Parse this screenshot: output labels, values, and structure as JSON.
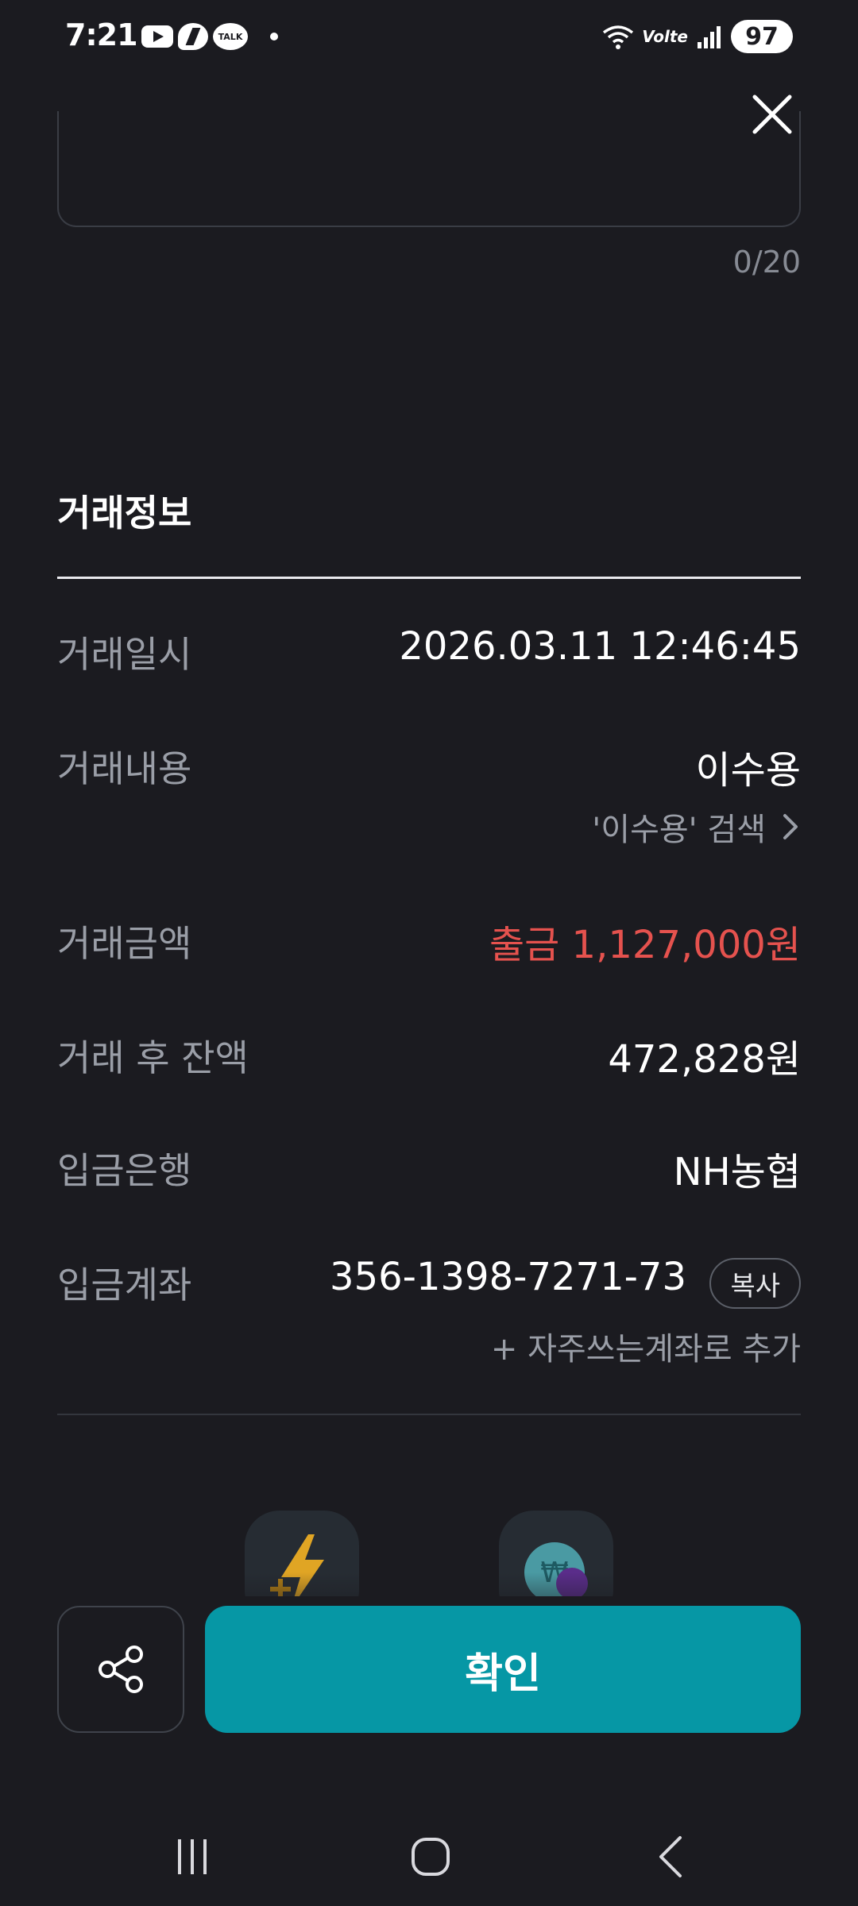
{
  "status_bar": {
    "time": "7:21",
    "notification_icons": [
      "youtube-icon",
      "messenger-icon",
      "kakaotalk-icon",
      "dot-icon"
    ],
    "talk_label": "TALK",
    "network_label": "Volte",
    "battery": "97"
  },
  "memo": {
    "counter": "0/20"
  },
  "transaction_info": {
    "title": "거래정보",
    "rows": [
      {
        "label": "거래일시",
        "value": "2026.03.11 12:46:45"
      },
      {
        "label": "거래내용",
        "value": "이수용",
        "sub_link": "'이수용' 검색"
      },
      {
        "label": "거래금액",
        "value": "출금 1,127,000원"
      },
      {
        "label": "거래 후 잔액",
        "value": "472,828원"
      },
      {
        "label": "입금은행",
        "value": "NH농협"
      },
      {
        "label": "입금계좌",
        "value": "356-1398-7271-73",
        "copy_label": "복사",
        "add_label": "+ 자주쓰는계좌로 추가"
      }
    ]
  },
  "actions": {
    "confirm_label": "확인"
  },
  "colors": {
    "background": "#1b1b20",
    "accent": "#0697a5",
    "withdrawal_red": "#e5524e",
    "muted_text": "#9a9ea7"
  }
}
